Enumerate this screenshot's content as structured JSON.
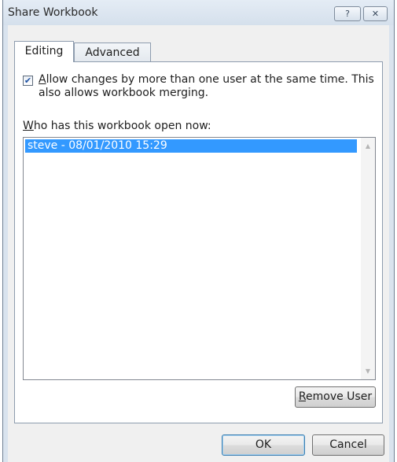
{
  "window": {
    "title": "Share Workbook",
    "help_glyph": "?",
    "close_glyph": "✕"
  },
  "tabs": [
    {
      "label": "Editing",
      "active": true
    },
    {
      "label": "Advanced",
      "active": false
    }
  ],
  "editing": {
    "allow_changes": {
      "checked": true,
      "check_glyph": "✔",
      "label_accel": "A",
      "label_rest": "llow changes by more than one user at the same time.  This also allows workbook merging."
    },
    "who_label_accel": "W",
    "who_label_rest": "ho has this workbook open now:",
    "users": [
      {
        "text": "steve - 08/01/2010 15:29",
        "selected": true
      }
    ],
    "scroll_up_glyph": "▲",
    "scroll_down_glyph": "▼",
    "remove_user_accel": "R",
    "remove_user_rest": "emove User"
  },
  "buttons": {
    "ok": "OK",
    "cancel": "Cancel"
  },
  "colors": {
    "selection": "#3399ff",
    "dialog_bg": "#f0f0f0"
  }
}
